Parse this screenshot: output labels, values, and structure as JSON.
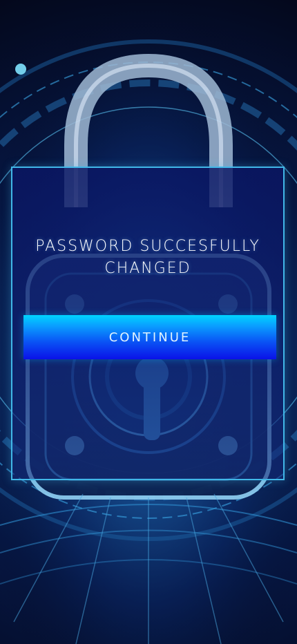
{
  "dialog": {
    "message": "PASSWORD SUCCESFULLY CHANGED",
    "button_label": "CONTINUE"
  },
  "background": {
    "icon": "padlock-icon"
  },
  "colors": {
    "dialog_border": "#41b7e8",
    "dialog_fill": "#0a1664",
    "button_top": "#00d4ff",
    "button_bottom": "#0a11e8",
    "text": "#ffffff"
  }
}
